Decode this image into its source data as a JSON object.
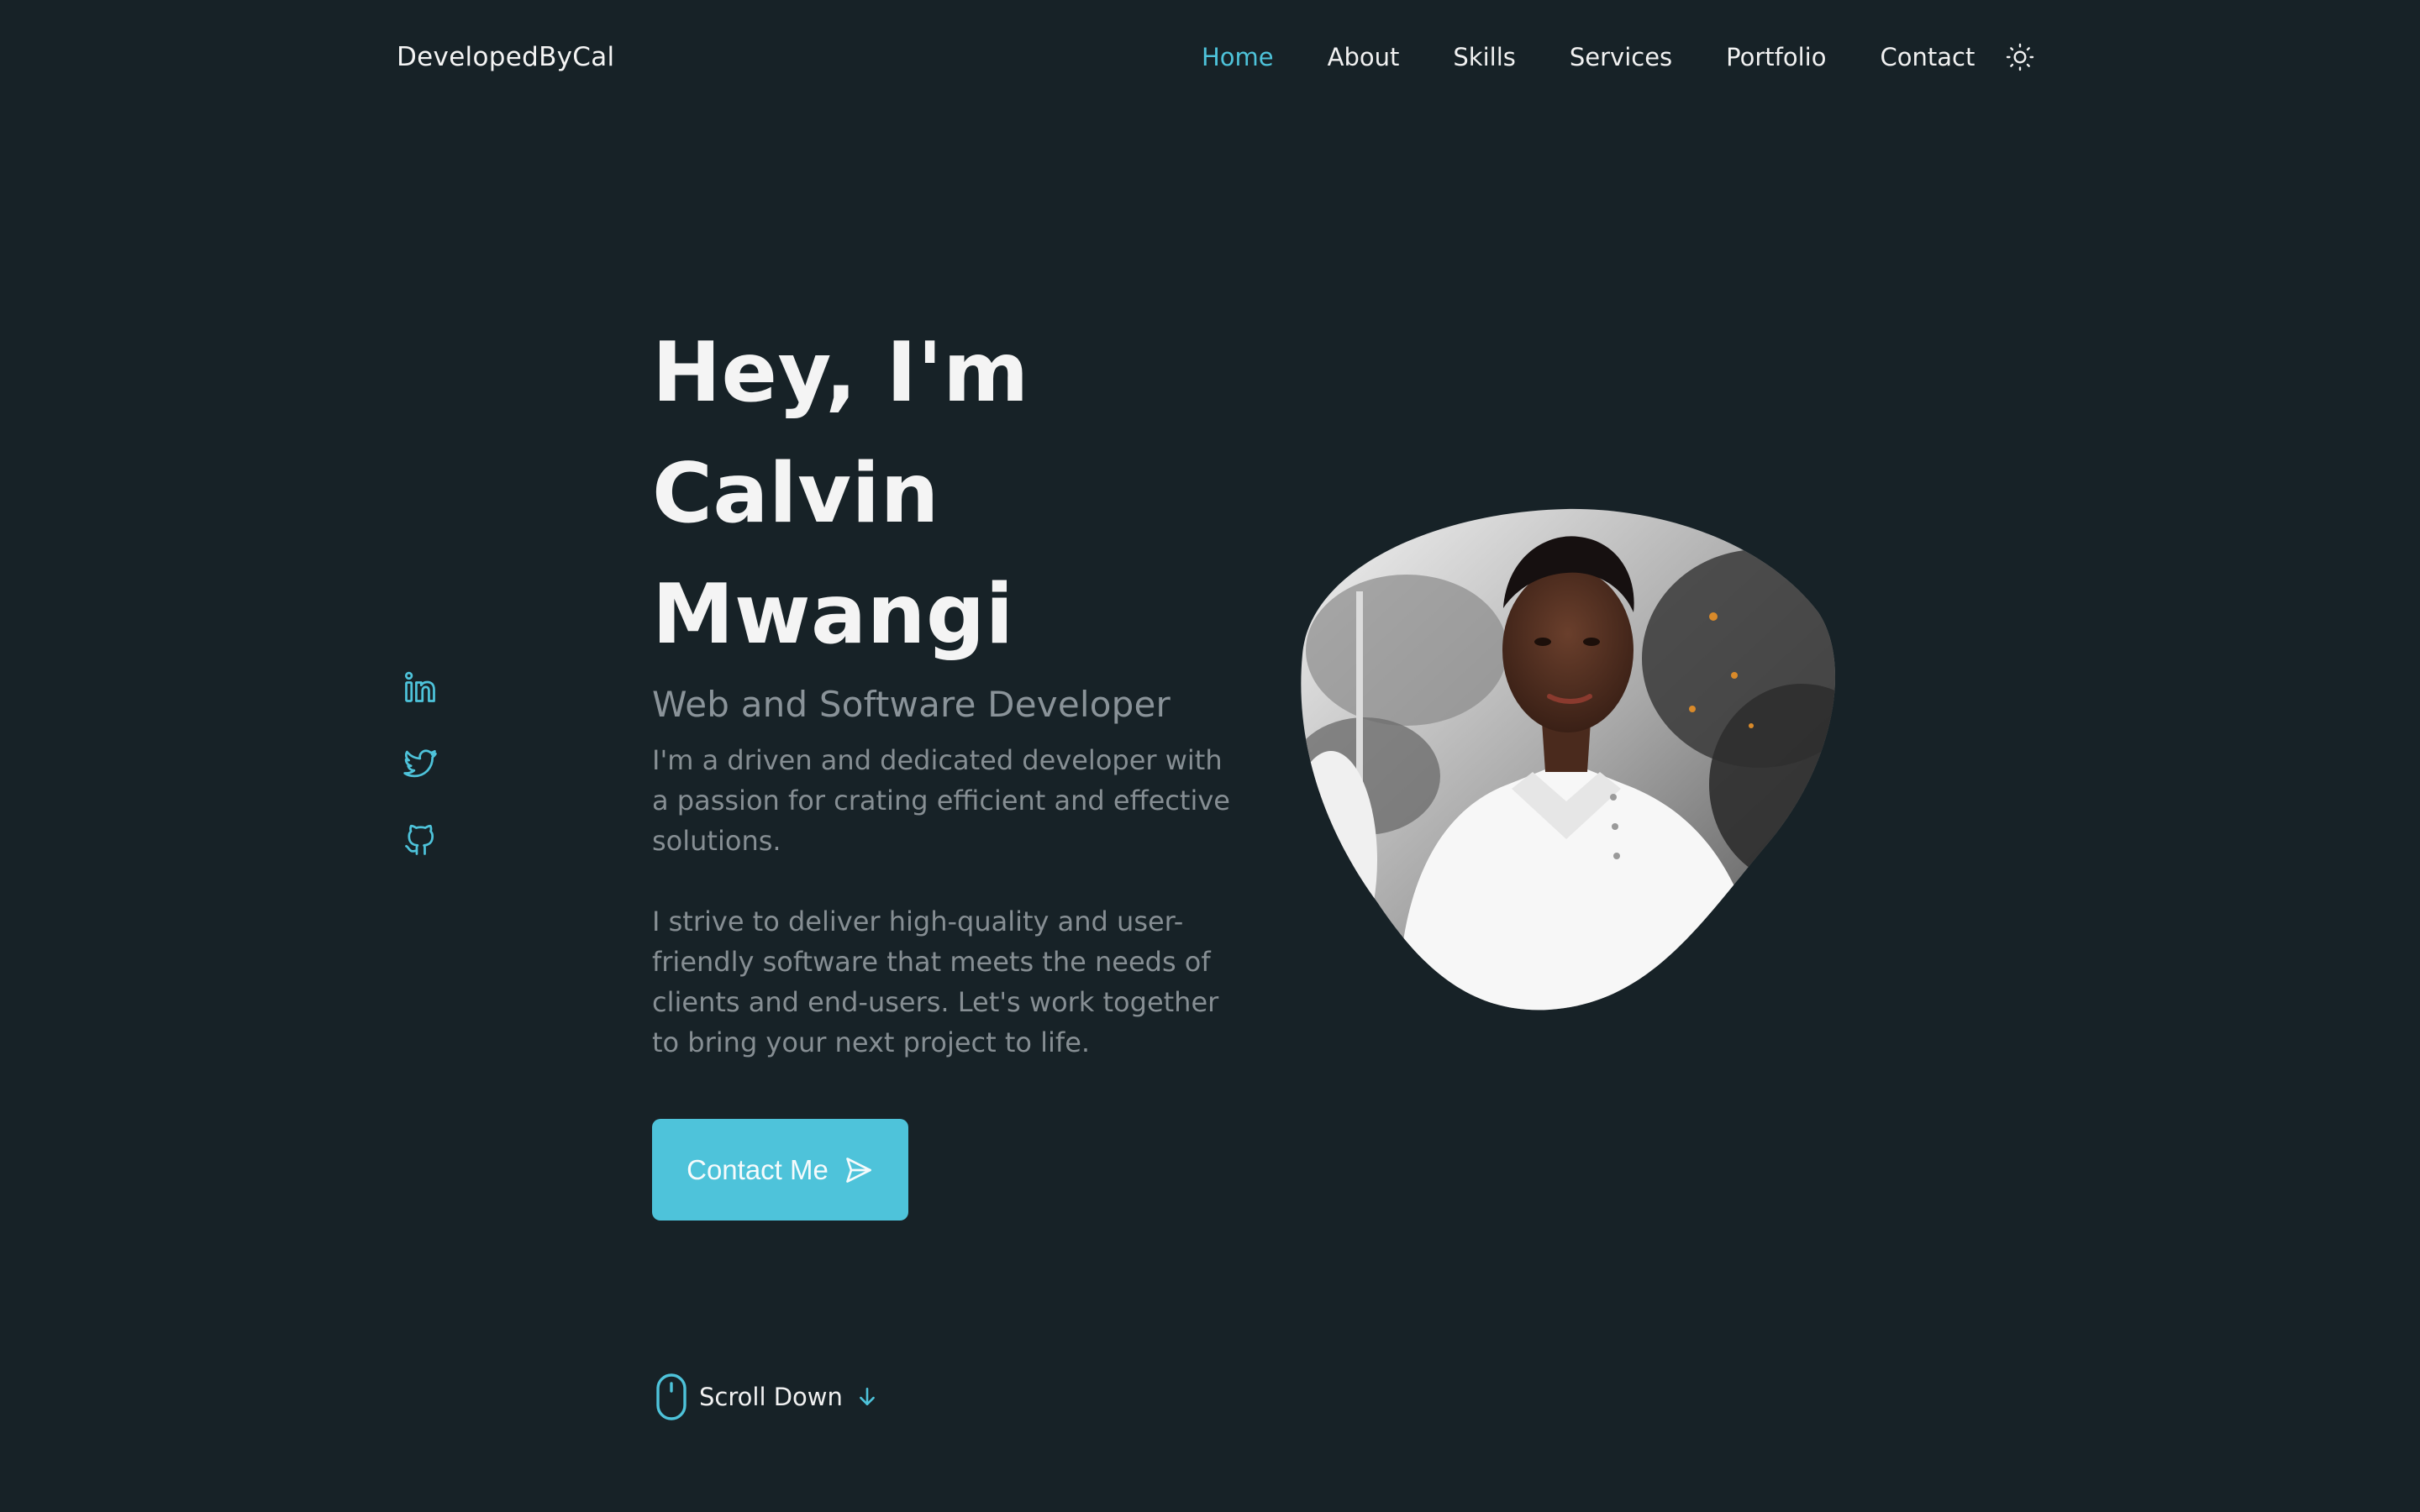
{
  "header": {
    "logo": "DevelopedByCal",
    "nav": [
      {
        "label": "Home",
        "active": true
      },
      {
        "label": "About"
      },
      {
        "label": "Skills"
      },
      {
        "label": "Services"
      },
      {
        "label": "Portfolio"
      },
      {
        "label": "Contact"
      }
    ],
    "theme_icon": "sun-icon"
  },
  "social": [
    {
      "icon": "linkedin-icon"
    },
    {
      "icon": "twitter-icon"
    },
    {
      "icon": "github-icon"
    }
  ],
  "hero": {
    "title_lines": [
      "Hey, I'm",
      "Calvin",
      "Mwangi"
    ],
    "subtitle": "Web and Software Developer",
    "paragraphs": [
      "I'm a driven and dedicated developer with a passion for crating efficient and effective solutions.",
      "I strive to deliver high-quality and user-friendly software that meets the needs of clients and end-users. Let's work together to bring your next project to life."
    ],
    "cta_label": "Contact Me",
    "cta_icon": "send-icon"
  },
  "scroll": {
    "label": "Scroll Down",
    "icon": "mouse-icon",
    "arrow_icon": "arrow-down-icon"
  },
  "colors": {
    "background": "#172227",
    "accent": "#4ec3da",
    "text": "#f2f2f2",
    "muted": "#868e93"
  }
}
